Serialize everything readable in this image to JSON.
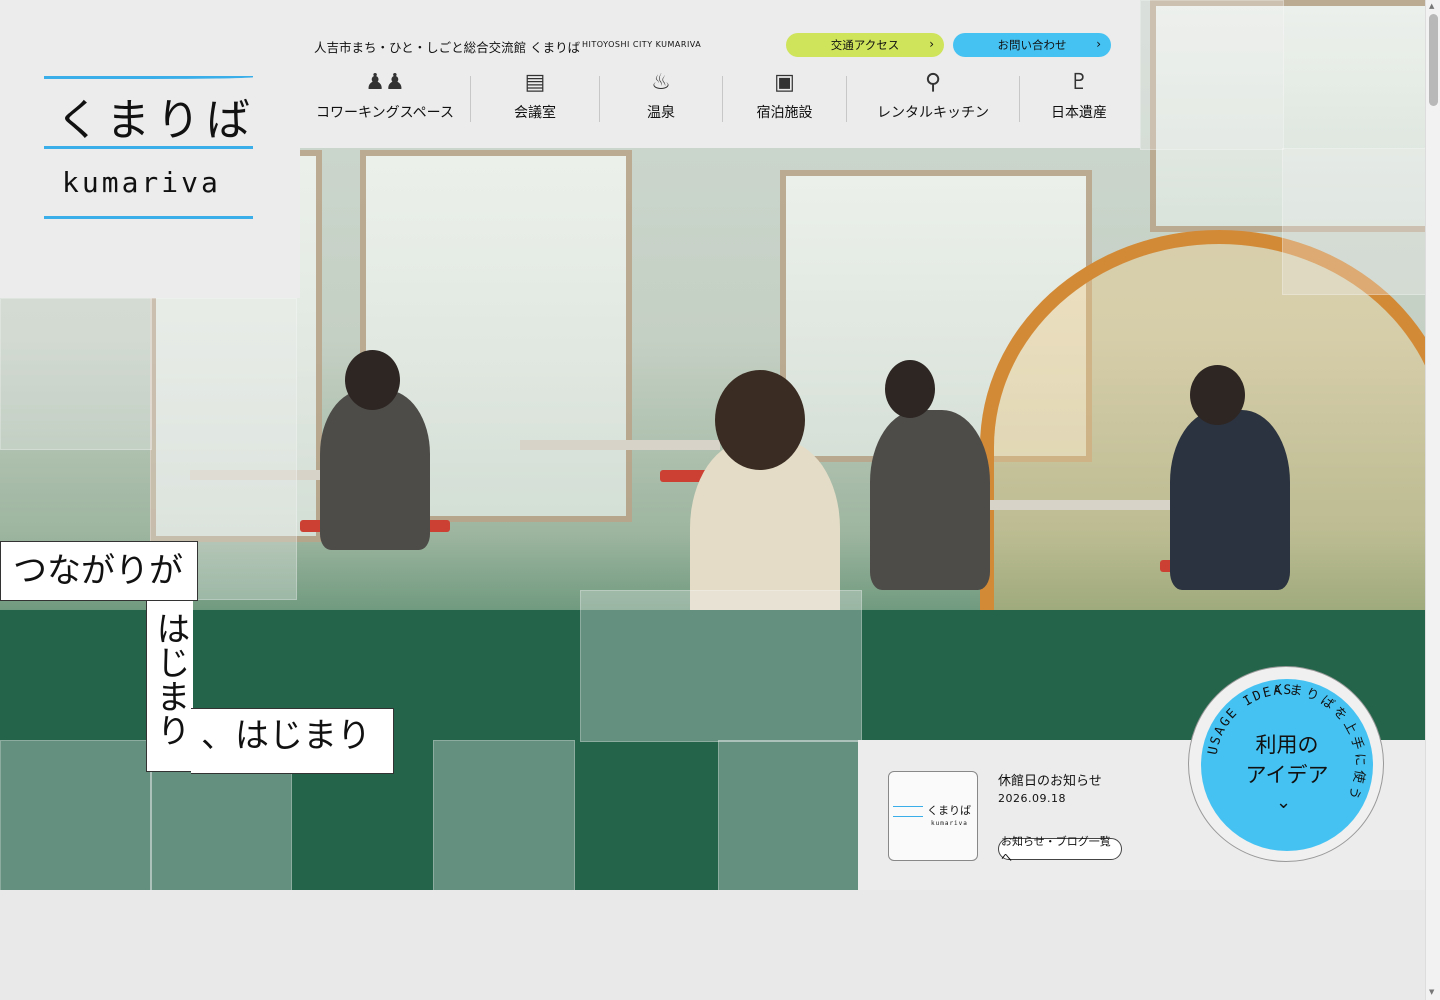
{
  "header": {
    "site_name": "人吉市まち・ひと・しごと総合交流館 くまりば",
    "site_name_en": "HITOYOSHI CITY KUMARIVA",
    "logo_jp": "くまりば",
    "logo_en": "kumariva",
    "access_label": "交通アクセス",
    "contact_label": "お問い合わせ",
    "access_color": "#cfe45a",
    "contact_color": "#46c2f2"
  },
  "nav": [
    {
      "label": "コワーキングスペース",
      "icon": "people-icon"
    },
    {
      "label": "会議室",
      "icon": "meeting-table-icon"
    },
    {
      "label": "温泉",
      "icon": "hot-spring-icon"
    },
    {
      "label": "宿泊施設",
      "icon": "bed-icon"
    },
    {
      "label": "レンタルキッチン",
      "icon": "kitchen-utensils-icon"
    },
    {
      "label": "日本遺産",
      "icon": "boot-icon"
    }
  ],
  "hero": {
    "tagline_line1": "つながりが",
    "tagline_line2": "はじまり",
    "tagline_line3": "、はじまり"
  },
  "news": {
    "title": "休館日のお知らせ",
    "date": "2026.09.18",
    "thumb_jp": "くまりば",
    "thumb_en": "kumariva",
    "list_button": "お知らせ・ブログ一覧へ"
  },
  "usage": {
    "title_line1": "利用の",
    "title_line2": "アイデア",
    "ring_jp": "くまりばを上手に使う",
    "ring_en": "USAGE IDEAS",
    "accent": "#46c2f2"
  }
}
